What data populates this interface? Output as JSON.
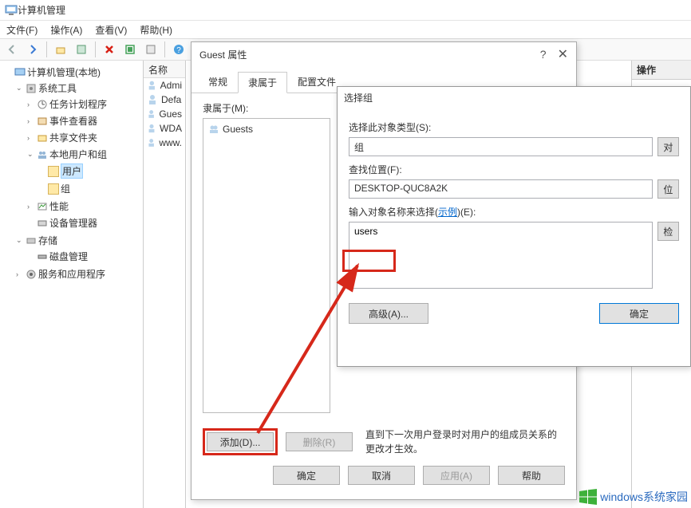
{
  "window": {
    "title": "计算机管理"
  },
  "menu": {
    "file": "文件(F)",
    "action": "操作(A)",
    "view": "查看(V)",
    "help": "帮助(H)"
  },
  "tree": {
    "root": "计算机管理(本地)",
    "systools": "系统工具",
    "tasksched": "任务计划程序",
    "eventvwr": "事件查看器",
    "shared": "共享文件夹",
    "lusrmgr": "本地用户和组",
    "users": "用户",
    "groups": "组",
    "perf": "性能",
    "devmgr": "设备管理器",
    "storage": "存储",
    "diskmgr": "磁盘管理",
    "services": "服务和应用程序"
  },
  "list": {
    "header_name": "名称",
    "items": [
      "Admi",
      "Defa",
      "Gues",
      "WDA",
      "www."
    ]
  },
  "ops": {
    "header": "操作"
  },
  "guest_dialog": {
    "title": "Guest 属性",
    "help": "?",
    "tabs": {
      "general": "常规",
      "memberof": "隶属于",
      "profile": "配置文件"
    },
    "memberof_label": "隶属于(M):",
    "member_item": "Guests",
    "add": "添加(D)...",
    "remove": "删除(R)",
    "note": "直到下一次用户登录时对用户的组成员关系的更改才生效。",
    "ok": "确定",
    "cancel": "取消",
    "apply": "应用(A)",
    "help_btn": "帮助"
  },
  "select_dialog": {
    "title": "选择组",
    "type_label": "选择此对象类型(S):",
    "type_value": "组",
    "obj_btn": "对",
    "loc_label": "查找位置(F):",
    "loc_value": "DESKTOP-QUC8A2K",
    "loc_btn": "位",
    "names_label_pre": "输入对象名称来选择(",
    "names_example": "示例",
    "names_label_post": ")(E):",
    "names_value": "users",
    "check_btn": "检",
    "advanced": "高级(A)...",
    "ok": "确定"
  },
  "watermark": {
    "text": "windows系统家园",
    "url": ""
  }
}
